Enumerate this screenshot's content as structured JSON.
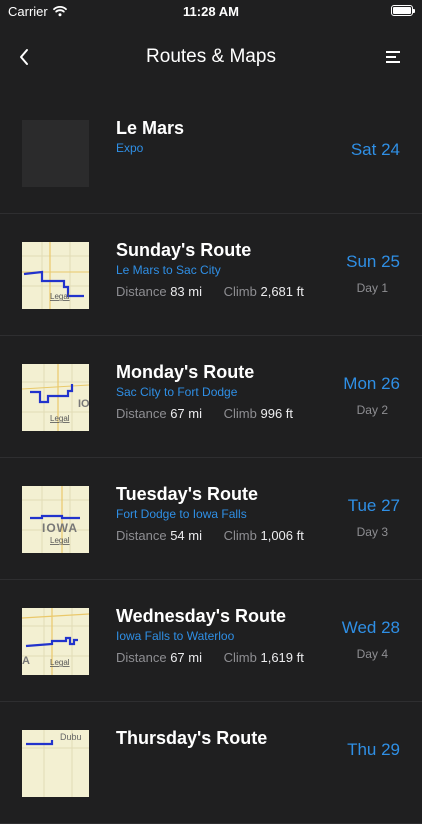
{
  "status": {
    "carrier": "Carrier",
    "time": "11:28 AM",
    "battery_level": 1.0
  },
  "nav": {
    "title": "Routes & Maps",
    "back_icon": "chevron-left-icon",
    "menu_icon": "menu-icon"
  },
  "legal_label": "Legal",
  "routes": [
    {
      "title": "Le Mars",
      "subtitle": "Expo",
      "date": "Sat 24",
      "day": "",
      "distance_label": "",
      "distance": "",
      "climb_label": "",
      "climb": "",
      "map_label": ""
    },
    {
      "title": "Sunday's Route",
      "subtitle": "Le Mars to Sac City",
      "date": "Sun 25",
      "day": "Day 1",
      "distance_label": "Distance",
      "distance": "83 mi",
      "climb_label": "Climb",
      "climb": "2,681 ft",
      "map_label": ""
    },
    {
      "title": "Monday's Route",
      "subtitle": "Sac City to Fort Dodge",
      "date": "Mon 26",
      "day": "Day 2",
      "distance_label": "Distance",
      "distance": "67 mi",
      "climb_label": "Climb",
      "climb": "996 ft",
      "map_label": "IO"
    },
    {
      "title": "Tuesday's Route",
      "subtitle": "Fort Dodge to Iowa Falls",
      "date": "Tue 27",
      "day": "Day 3",
      "distance_label": "Distance",
      "distance": "54 mi",
      "climb_label": "Climb",
      "climb": "1,006 ft",
      "map_label": "IOWA"
    },
    {
      "title": "Wednesday's Route",
      "subtitle": "Iowa Falls to Waterloo",
      "date": "Wed 28",
      "day": "Day 4",
      "distance_label": "Distance",
      "distance": "67 mi",
      "climb_label": "Climb",
      "climb": "1,619 ft",
      "map_label": "A"
    },
    {
      "title": "Thursday's Route",
      "subtitle": "",
      "date": "Thu 29",
      "day": "",
      "distance_label": "",
      "distance": "",
      "climb_label": "",
      "climb": "",
      "map_label": "Dubu"
    }
  ],
  "colors": {
    "accent": "#2f8fe5",
    "route_line": "#2233cc",
    "map_bg": "#f3f0d2"
  }
}
